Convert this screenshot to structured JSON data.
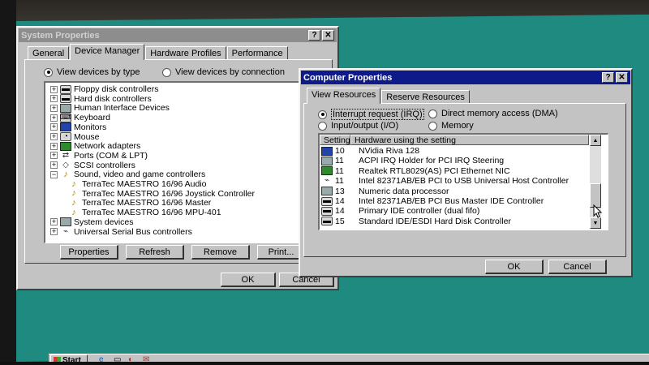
{
  "system_properties": {
    "title": "System Properties",
    "tabs": [
      "General",
      "Device Manager",
      "Hardware Profiles",
      "Performance"
    ],
    "view_by_type": "View devices by type",
    "view_by_connection": "View devices by connection",
    "tree": [
      {
        "label": "Floppy disk controllers",
        "expander": "+",
        "icon": "drive-icon"
      },
      {
        "label": "Hard disk controllers",
        "expander": "+",
        "icon": "drive-icon"
      },
      {
        "label": "Human Interface Devices",
        "expander": "+",
        "icon": "hid-icon"
      },
      {
        "label": "Keyboard",
        "expander": "+",
        "icon": "keyboard-icon"
      },
      {
        "label": "Monitors",
        "expander": "+",
        "icon": "monitor-icon"
      },
      {
        "label": "Mouse",
        "expander": "+",
        "icon": "mouse-icon"
      },
      {
        "label": "Network adapters",
        "expander": "+",
        "icon": "network-icon"
      },
      {
        "label": "Ports (COM & LPT)",
        "expander": "+",
        "icon": "port-icon"
      },
      {
        "label": "SCSI controllers",
        "expander": "+",
        "icon": "scsi-icon"
      },
      {
        "label": "Sound, video and game controllers",
        "expander": "−",
        "icon": "speaker-icon"
      },
      {
        "label": "TerraTec MAESTRO 16/96 Audio",
        "expander": "",
        "icon": "speaker-icon"
      },
      {
        "label": "TerraTec MAESTRO 16/96 Joystick Controller",
        "expander": "",
        "icon": "speaker-icon"
      },
      {
        "label": "TerraTec MAESTRO 16/96 Master",
        "expander": "",
        "icon": "speaker-icon"
      },
      {
        "label": "TerraTec MAESTRO 16/96 MPU-401",
        "expander": "",
        "icon": "speaker-icon"
      },
      {
        "label": "System devices",
        "expander": "+",
        "icon": "computer-icon"
      },
      {
        "label": "Universal Serial Bus controllers",
        "expander": "+",
        "icon": "usb-icon"
      }
    ],
    "buttons": {
      "properties": "Properties",
      "refresh": "Refresh",
      "remove": "Remove",
      "print": "Print..."
    },
    "ok": "OK",
    "cancel": "Cancel"
  },
  "computer_properties": {
    "title": "Computer Properties",
    "tabs": [
      "View Resources",
      "Reserve Resources"
    ],
    "radios": {
      "irq": "Interrupt request (IRQ)",
      "dma": "Direct memory access (DMA)",
      "io": "Input/output (I/O)",
      "memory": "Memory"
    },
    "columns": [
      "Setting",
      "Hardware using the setting"
    ],
    "rows": [
      {
        "setting": "10",
        "hardware": "NVidia Riva 128",
        "icon": "monitor-icon"
      },
      {
        "setting": "11",
        "hardware": "ACPI IRQ Holder for PCI IRQ Steering",
        "icon": "computer-icon"
      },
      {
        "setting": "11",
        "hardware": "Realtek RTL8029(AS) PCI Ethernet NIC",
        "icon": "network-icon"
      },
      {
        "setting": "11",
        "hardware": "Intel 82371AB/EB PCI to USB Universal Host Controller",
        "icon": "usb-icon"
      },
      {
        "setting": "13",
        "hardware": "Numeric data processor",
        "icon": "computer-icon"
      },
      {
        "setting": "14",
        "hardware": "Intel 82371AB/EB PCI Bus Master IDE Controller",
        "icon": "drive-icon"
      },
      {
        "setting": "14",
        "hardware": "Primary IDE controller (dual fifo)",
        "icon": "drive-icon"
      },
      {
        "setting": "15",
        "hardware": "Standard IDE/ESDI Hard Disk Controller",
        "icon": "drive-icon"
      }
    ],
    "ok": "OK",
    "cancel": "Cancel"
  },
  "taskbar": {
    "start": "Start"
  },
  "title_buttons": {
    "help": "?",
    "close": "✕"
  }
}
